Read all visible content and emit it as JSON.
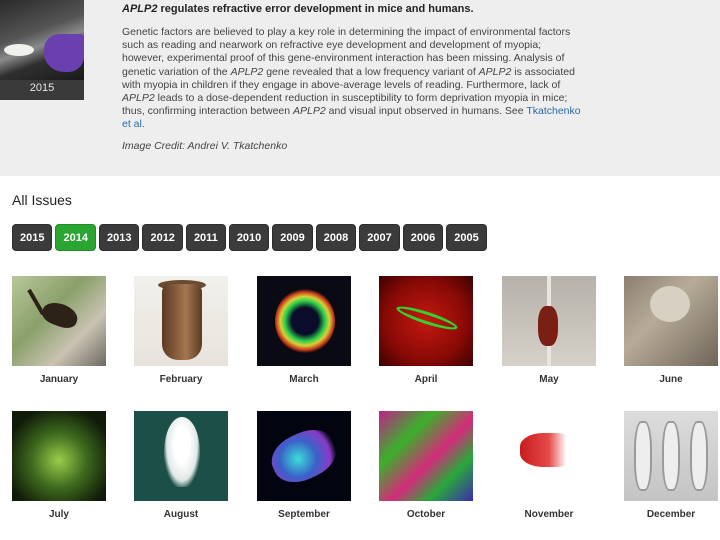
{
  "feature": {
    "thumb_year": "2015",
    "title_gene": "APLP2",
    "title_rest": " regulates refractive error development in mice and humans.",
    "body_1": "Genetic factors are believed to play a key role in determining the impact of environmental factors such as reading and nearwork on refractive eye development and development of myopia; however, experimental proof of this gene-environment interaction has been missing. Analysis of genetic variation of the ",
    "gene_1": "APLP2",
    "body_2": " gene revealed that a low frequency variant of ",
    "gene_2": "APLP2",
    "body_3": " is associated with myopia in children if they engage in above-average levels of reading. Furthermore, lack of ",
    "gene_3": "APLP2",
    "body_4": " leads to a dose-dependent reduction in susceptibility to form deprivation myopia in mice; thus, confirming interaction between ",
    "gene_4": "APLP2",
    "body_5": " and visual input observed in humans. See ",
    "link": "Tkatchenko et al.",
    "credit": "Image Credit: Andrei V. Tkatchenko"
  },
  "section_title": "All Issues",
  "years": [
    "2015",
    "2014",
    "2013",
    "2012",
    "2011",
    "2010",
    "2009",
    "2008",
    "2007",
    "2006",
    "2005"
  ],
  "active_year": "2014",
  "issues": [
    {
      "month": "January"
    },
    {
      "month": "February"
    },
    {
      "month": "March"
    },
    {
      "month": "April"
    },
    {
      "month": "May"
    },
    {
      "month": "June"
    },
    {
      "month": "July"
    },
    {
      "month": "August"
    },
    {
      "month": "September"
    },
    {
      "month": "October"
    },
    {
      "month": "November"
    },
    {
      "month": "December"
    }
  ]
}
